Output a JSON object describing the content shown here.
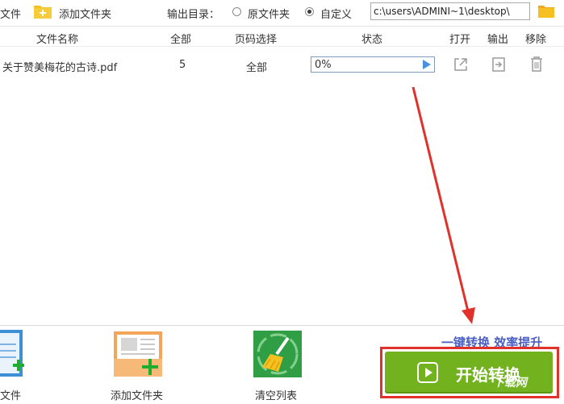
{
  "toolbar": {
    "add_file_label": "文件",
    "add_folder_label": "添加文件夹",
    "output_dir_label": "输出目录：",
    "radio_original": "原文件夹",
    "radio_custom": "自定义",
    "selected_radio": "自定义",
    "output_path": "c:\\users\\ADMINI~1\\desktop\\"
  },
  "table": {
    "headers": {
      "filename": "文件名称",
      "total": "全部",
      "page_select": "页码选择",
      "status": "状态",
      "open": "打开",
      "output": "输出",
      "remove": "移除"
    },
    "rows": [
      {
        "filename": "关于赞美梅花的古诗.pdf",
        "total": "5",
        "page_select": "全部",
        "progress": "0%"
      }
    ]
  },
  "bottom": {
    "add_file_label": "文件",
    "add_folder_label": "添加文件夹",
    "clear_list_label": "清空列表",
    "slogan": "一键转换  效率提升",
    "start_label": "开始转换",
    "watermark": "下载网"
  },
  "colors": {
    "start_button": "#72b21e",
    "highlight_border": "#e0322b",
    "arrow": "#e0322b",
    "progress_play": "#4a90e2",
    "folder_yellow": "#f5c022",
    "slogan": "#4a5fc4"
  }
}
